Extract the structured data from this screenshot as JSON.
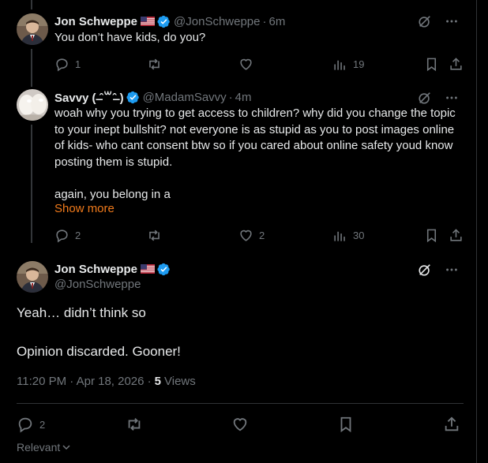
{
  "tweets": [
    {
      "name": "Jon Schweppe",
      "flag": "🇺🇸",
      "handle": "@JonSchweppe",
      "time": "6m",
      "text": "You don’t have kids, do you?",
      "replies": "1",
      "retweets": "",
      "likes": "",
      "views": "19"
    },
    {
      "name": "Savvy ( ̶ˆ꒳ˆ̶ )",
      "handle": "@MadamSavvy",
      "time": "4m",
      "text": "woah why you trying to get access to children? why did you change the topic to your inept bullshit? not everyone is as stupid as you to post images online of kids- who cant consent btw so if you cared about online safety youd know posting them is stupid.\n\nagain, you belong in a",
      "show_more": "Show more",
      "replies": "2",
      "retweets": "",
      "likes": "2",
      "views": "30"
    }
  ],
  "main": {
    "name": "Jon Schweppe",
    "flag": "🇺🇸",
    "handle": "@JonSchweppe",
    "line1": "Yeah… didn’t think so",
    "line2": "Opinion discarded. Gooner!",
    "timestamp": "11:20 PM · Apr 18, 2026 ·",
    "views_count": "5",
    "views_label": "Views",
    "replies": "2"
  },
  "relevant_label": "Relevant",
  "dot": "·",
  "colors": {
    "background": "#000000",
    "text": "#e7e9ea",
    "muted": "#71767b",
    "verified": "#1d9bf0",
    "show_more": "#f07a1b"
  },
  "icons": [
    "grok-icon",
    "more-icon",
    "reply-icon",
    "retweet-icon",
    "like-icon",
    "views-icon",
    "bookmark-icon",
    "share-icon",
    "verified-icon",
    "us-flag-icon",
    "chevron-down-icon"
  ]
}
